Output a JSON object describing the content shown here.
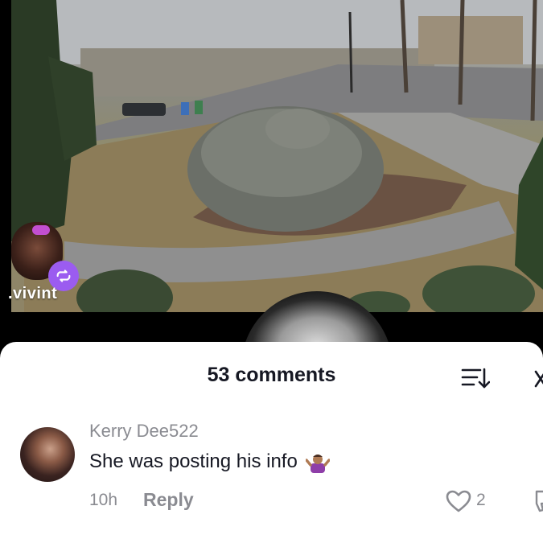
{
  "video": {
    "watermark": ".vivint",
    "repost_icon": "repost-icon"
  },
  "comments": {
    "title": "53 comments",
    "sort_icon": "sort-icon",
    "close_icon": "close-icon",
    "items": [
      {
        "username": "Kerry Dee522",
        "text": "She was posting his info",
        "emoji": "shrug-emoji",
        "time": "10h",
        "reply_label": "Reply",
        "like_count": "2"
      }
    ]
  },
  "colors": {
    "accent_repost": "#9b5cf0",
    "text_primary": "#161823",
    "text_secondary": "#8a8b91"
  }
}
